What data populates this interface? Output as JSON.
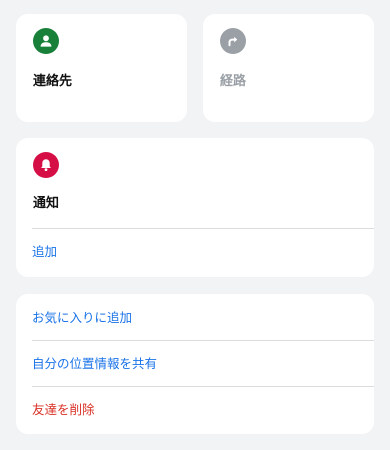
{
  "tiles": {
    "contact": {
      "label": "連絡先",
      "icon": "person-icon",
      "icon_color": "#188038"
    },
    "directions": {
      "label": "経路",
      "icon": "directions-icon",
      "icon_color": "#9aa0a6"
    }
  },
  "notification": {
    "label": "通知",
    "icon": "bell-icon",
    "icon_color": "#d50f46",
    "add_label": "追加"
  },
  "actions": {
    "favorite": "お気に入りに追加",
    "share_location": "自分の位置情報を共有",
    "remove_friend": "友達を削除"
  },
  "colors": {
    "background": "#f1f3f5",
    "link_blue": "#1a73e8",
    "destructive_red": "#d93025",
    "label_black": "#111111",
    "label_gray": "#9aa0a6"
  }
}
